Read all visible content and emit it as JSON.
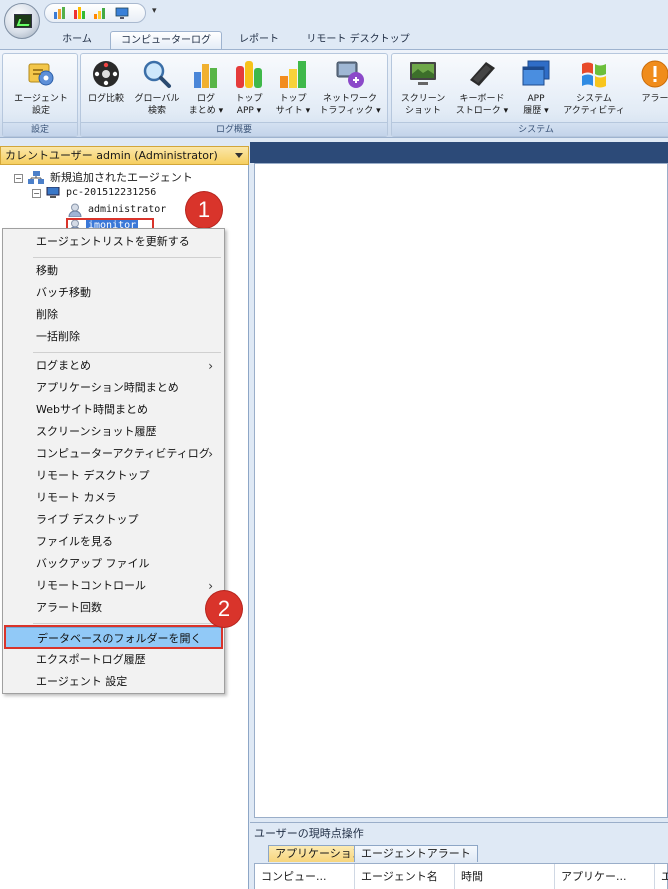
{
  "tabs": [
    "ホーム",
    "コンピューターログ",
    "レポート",
    "リモート デスクトップ"
  ],
  "ribbon": {
    "group_settings": {
      "label": "設定",
      "buttons": [
        {
          "line1": "エージェント",
          "line2": "設定",
          "icon": "agent-settings-icon"
        }
      ]
    },
    "group_logs": {
      "label": "ログ概要",
      "buttons": [
        {
          "line1": "ログ比較",
          "line2": "",
          "icon": "log-compare-icon"
        },
        {
          "line1": "グローバル",
          "line2": "検索",
          "icon": "global-search-icon"
        },
        {
          "line1": "ログ",
          "line2": "まとめ ▾",
          "icon": "log-summary-icon"
        },
        {
          "line1": "トップ",
          "line2": "APP ▾",
          "icon": "top-app-icon"
        },
        {
          "line1": "トップ",
          "line2": "サイト ▾",
          "icon": "top-site-icon"
        },
        {
          "line1": "ネットワーク",
          "line2": "トラフィック ▾",
          "icon": "network-traffic-icon"
        }
      ]
    },
    "group_system": {
      "label": "システム",
      "buttons": [
        {
          "line1": "スクリーン",
          "line2": "ショット",
          "icon": "screenshot-icon"
        },
        {
          "line1": "キーボード",
          "line2": "ストローク ▾",
          "icon": "keyboard-icon"
        },
        {
          "line1": "APP",
          "line2": "履歴 ▾",
          "icon": "app-history-icon"
        },
        {
          "line1": "システム",
          "line2": "アクティビティ",
          "icon": "windows-icon"
        },
        {
          "line1": "アラー",
          "line2": "",
          "icon": "alert-icon"
        }
      ]
    }
  },
  "left_panel": {
    "header": "カレントユーザー admin (Administrator)",
    "tree": {
      "root": "新規追加されたエージェント",
      "computer": "pc-201512231256",
      "user1": "administrator",
      "user2": "imonitor"
    }
  },
  "badges": {
    "one": "1",
    "two": "2"
  },
  "context_menu": {
    "items": [
      {
        "label": "エージェントリストを更新する",
        "submenu": false
      },
      {
        "label": "移動",
        "submenu": false
      },
      {
        "label": "バッチ移動",
        "submenu": false
      },
      {
        "label": "削除",
        "submenu": false
      },
      {
        "label": "一括削除",
        "submenu": false
      },
      {
        "label": "ログまとめ",
        "submenu": true
      },
      {
        "label": "アプリケーション時間まとめ",
        "submenu": false
      },
      {
        "label": "Webサイト時間まとめ",
        "submenu": false
      },
      {
        "label": "スクリーンショット履歴",
        "submenu": false
      },
      {
        "label": "コンピューターアクティビティログ",
        "submenu": true
      },
      {
        "label": "リモート デスクトップ",
        "submenu": false
      },
      {
        "label": "リモート カメラ",
        "submenu": false
      },
      {
        "label": "ライブ デスクトップ",
        "submenu": false
      },
      {
        "label": "ファイルを見る",
        "submenu": false
      },
      {
        "label": "バックアップ ファイル",
        "submenu": false
      },
      {
        "label": "リモートコントロール",
        "submenu": true
      },
      {
        "label": "アラート回数",
        "submenu": false
      },
      {
        "label": "データベースのフォルダーを開く",
        "submenu": false
      },
      {
        "label": "エクスポートログ履歴",
        "submenu": false
      },
      {
        "label": "エージェント 設定",
        "submenu": false
      }
    ],
    "arrow": "›"
  },
  "bottom_panel": {
    "title": "ユーザーの現時点操作",
    "tabs": [
      "アプリケーション",
      "エージェントアラート"
    ],
    "columns": [
      "コンピュー...",
      "エージェント名",
      "時間",
      "アプリケー...",
      "エ"
    ]
  },
  "colors": {
    "accent_red": "#d9342b",
    "selected_item": "#91c9f7",
    "header_gold": "#f6cf61",
    "dark_blue": "#2c4a78"
  }
}
